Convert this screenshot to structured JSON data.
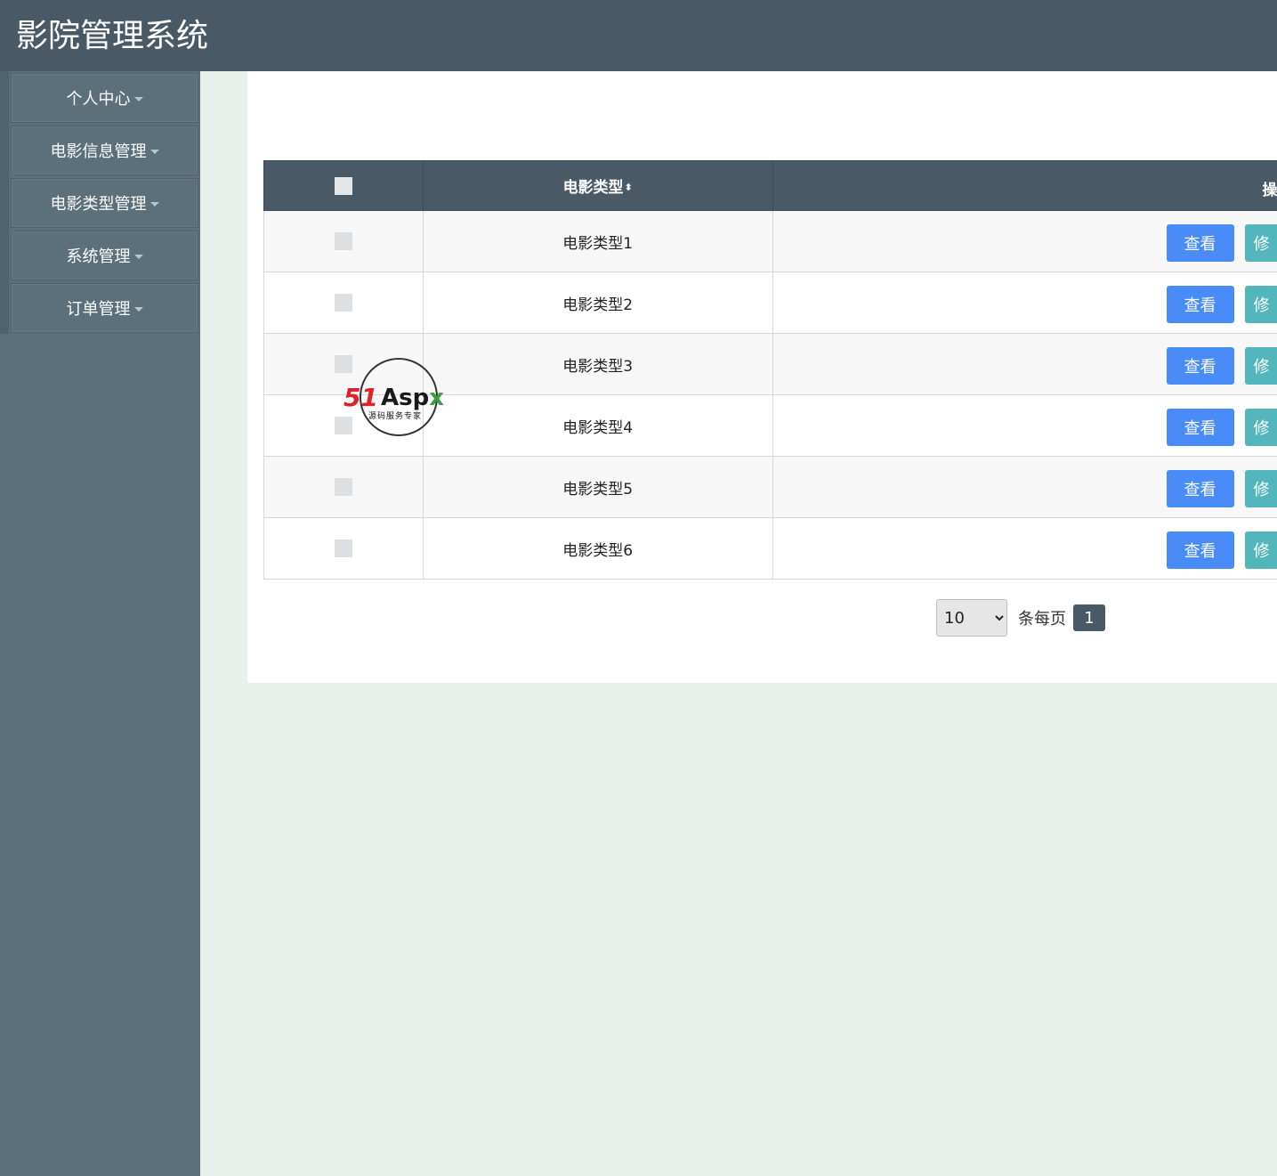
{
  "header": {
    "title": "影院管理系统"
  },
  "sidebar": {
    "items": [
      {
        "label": "个人中心"
      },
      {
        "label": "电影信息管理"
      },
      {
        "label": "电影类型管理"
      },
      {
        "label": "系统管理"
      },
      {
        "label": "订单管理"
      }
    ]
  },
  "table": {
    "columns": {
      "type": "电影类型",
      "sort_icon": "⬍",
      "operation": "操"
    },
    "rows": [
      {
        "type": "电影类型1"
      },
      {
        "type": "电影类型2"
      },
      {
        "type": "电影类型3"
      },
      {
        "type": "电影类型4"
      },
      {
        "type": "电影类型5"
      },
      {
        "type": "电影类型6"
      }
    ],
    "view_label": "查看",
    "edit_label": "修"
  },
  "pager": {
    "page_size": "10",
    "per_page_label": "条每页",
    "current_page": "1"
  },
  "watermark": {
    "brand_51": "51",
    "brand_aspx": "Asp",
    "brand_x": "x",
    "subtitle": "源码服务专家"
  }
}
